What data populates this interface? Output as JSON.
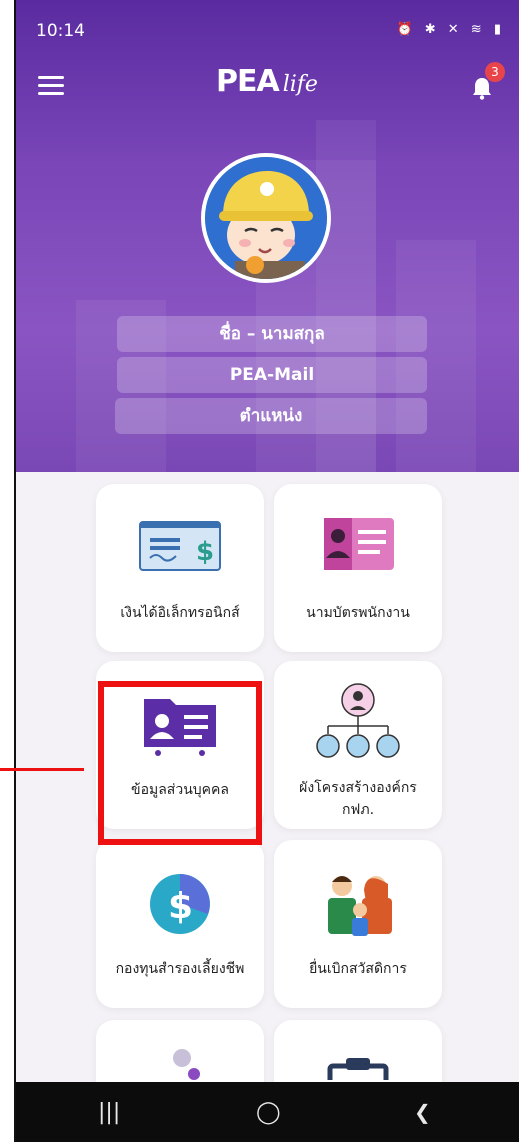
{
  "status_bar": {
    "time": "10:14",
    "icons_text": "⏰ ✱ ✕ ≋ ▮"
  },
  "header": {
    "brand_main": "PEA",
    "brand_sub": "life",
    "notification_count": "3",
    "avatar_icon": "mascot-avatar"
  },
  "profile": {
    "name_label": "ชื่อ – นามสกุล",
    "mail_label": "PEA-Mail",
    "position_label": "ตำแหน่ง"
  },
  "menu": {
    "items": [
      {
        "label": "เงินได้อิเล็กทรอนิกส์",
        "icon": "salary-slip-icon"
      },
      {
        "label": "นามบัตรพนักงาน",
        "icon": "id-card-icon"
      },
      {
        "label": "ข้อมูลส่วนบุคคล",
        "icon": "personal-info-folder-icon"
      },
      {
        "label": "ผังโครงสร้างองค์กร\nกฟภ.",
        "icon": "org-chart-icon"
      },
      {
        "label": "กองทุนสำรองเลี้ยงชีพ",
        "icon": "provident-fund-icon"
      },
      {
        "label": "ยื่นเบิกสวัสดิการ",
        "icon": "family-welfare-icon"
      }
    ]
  },
  "colors": {
    "header_purple": "#7a46b8",
    "highlight_red": "#ee1111",
    "notification_red": "#e8454a"
  },
  "navbar": {
    "recent": "|||",
    "home": "◯",
    "back": "❮"
  }
}
